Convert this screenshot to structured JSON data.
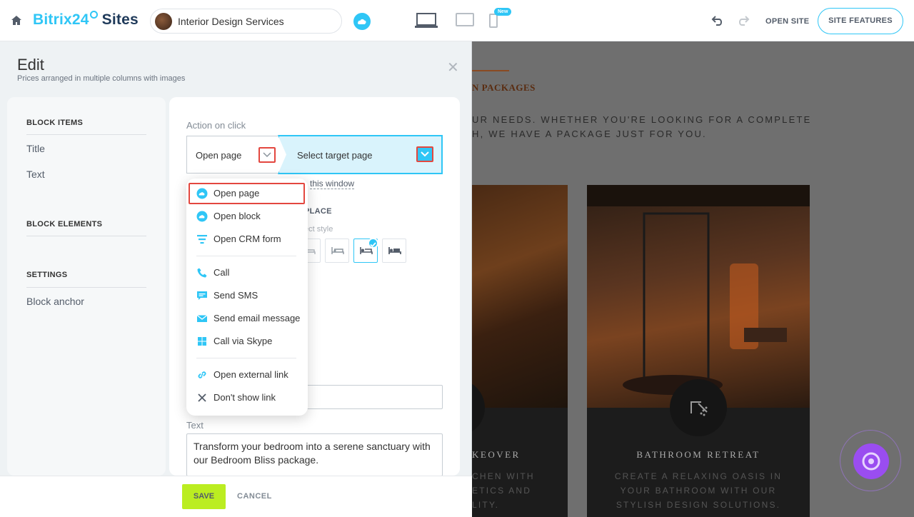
{
  "topbar": {
    "logo_brand": "Bitrix24",
    "logo_product": "Sites",
    "site_name": "Interior Design Services",
    "new_badge": "New",
    "open_site": "OPEN SITE",
    "site_features": "SITE FEATURES"
  },
  "editor": {
    "title": "Edit",
    "subtitle": "Prices arranged in multiple columns with images",
    "nav": {
      "block_items_head": "BLOCK ITEMS",
      "items": [
        "Title",
        "Text"
      ],
      "block_elements_head": "BLOCK ELEMENTS",
      "settings_head": "SETTINGS",
      "settings_items": [
        "Block anchor"
      ]
    },
    "form": {
      "action_label": "Action on click",
      "action_value": "Open page",
      "target_value": "Select target page",
      "window_link": "this window",
      "place_label": "PLACE",
      "style_label": "ect style",
      "text_label": "Text",
      "text_value": "Transform your bedroom into a serene sanctuary with our Bedroom Bliss package."
    },
    "save": "SAVE",
    "cancel": "CANCEL"
  },
  "menu": {
    "items": [
      {
        "label": "Open page",
        "icon": "cloud-page-icon"
      },
      {
        "label": "Open block",
        "icon": "cloud-block-icon"
      },
      {
        "label": "Open CRM form",
        "icon": "crm-form-icon"
      },
      {
        "label": "Call",
        "icon": "phone-icon"
      },
      {
        "label": "Send SMS",
        "icon": "sms-icon"
      },
      {
        "label": "Send email message",
        "icon": "email-icon"
      },
      {
        "label": "Call via Skype",
        "icon": "skype-icon"
      },
      {
        "label": "Open external link",
        "icon": "link-icon"
      },
      {
        "label": "Don't show link",
        "icon": "close-icon"
      }
    ]
  },
  "preview": {
    "heading": "N PACKAGES",
    "text_line1": "UR NEEDS. WHETHER YOU'RE LOOKING FOR A COMPLETE",
    "text_line2": "H, WE HAVE A PACKAGE JUST FOR YOU.",
    "card1_title": "KEOVER",
    "card1_desc": "CHEN WITH\nETICS AND\nLITY.",
    "card2_title": "BATHROOM RETREAT",
    "card2_desc": "CREATE A RELAXING OASIS IN\nYOUR BATHROOM WITH OUR\nSTYLISH DESIGN SOLUTIONS."
  },
  "colors": {
    "accent": "#2fc6f6",
    "save_green": "#bbed21",
    "highlight_red": "#e3473f"
  }
}
